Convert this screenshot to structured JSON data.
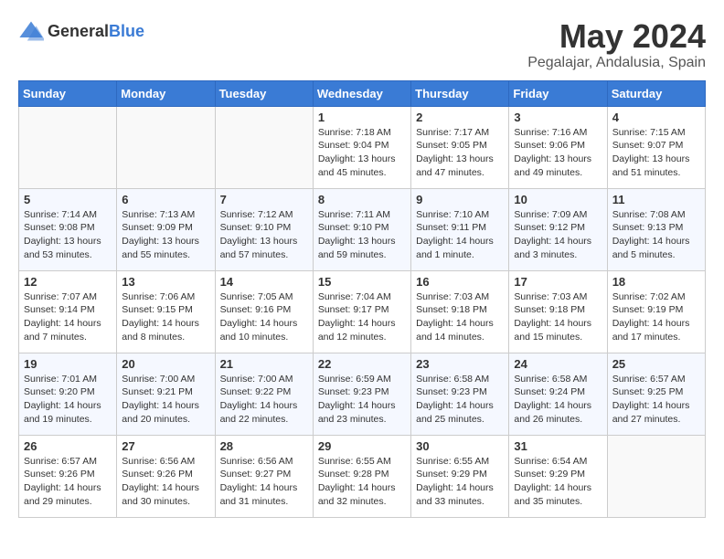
{
  "logo": {
    "general": "General",
    "blue": "Blue"
  },
  "title": "May 2024",
  "subtitle": "Pegalajar, Andalusia, Spain",
  "days": [
    "Sunday",
    "Monday",
    "Tuesday",
    "Wednesday",
    "Thursday",
    "Friday",
    "Saturday"
  ],
  "weeks": [
    [
      {
        "date": "",
        "sunrise": "",
        "sunset": "",
        "daylight": ""
      },
      {
        "date": "",
        "sunrise": "",
        "sunset": "",
        "daylight": ""
      },
      {
        "date": "",
        "sunrise": "",
        "sunset": "",
        "daylight": ""
      },
      {
        "date": "1",
        "sunrise": "Sunrise: 7:18 AM",
        "sunset": "Sunset: 9:04 PM",
        "daylight": "Daylight: 13 hours and 45 minutes."
      },
      {
        "date": "2",
        "sunrise": "Sunrise: 7:17 AM",
        "sunset": "Sunset: 9:05 PM",
        "daylight": "Daylight: 13 hours and 47 minutes."
      },
      {
        "date": "3",
        "sunrise": "Sunrise: 7:16 AM",
        "sunset": "Sunset: 9:06 PM",
        "daylight": "Daylight: 13 hours and 49 minutes."
      },
      {
        "date": "4",
        "sunrise": "Sunrise: 7:15 AM",
        "sunset": "Sunset: 9:07 PM",
        "daylight": "Daylight: 13 hours and 51 minutes."
      }
    ],
    [
      {
        "date": "5",
        "sunrise": "Sunrise: 7:14 AM",
        "sunset": "Sunset: 9:08 PM",
        "daylight": "Daylight: 13 hours and 53 minutes."
      },
      {
        "date": "6",
        "sunrise": "Sunrise: 7:13 AM",
        "sunset": "Sunset: 9:09 PM",
        "daylight": "Daylight: 13 hours and 55 minutes."
      },
      {
        "date": "7",
        "sunrise": "Sunrise: 7:12 AM",
        "sunset": "Sunset: 9:10 PM",
        "daylight": "Daylight: 13 hours and 57 minutes."
      },
      {
        "date": "8",
        "sunrise": "Sunrise: 7:11 AM",
        "sunset": "Sunset: 9:10 PM",
        "daylight": "Daylight: 13 hours and 59 minutes."
      },
      {
        "date": "9",
        "sunrise": "Sunrise: 7:10 AM",
        "sunset": "Sunset: 9:11 PM",
        "daylight": "Daylight: 14 hours and 1 minute."
      },
      {
        "date": "10",
        "sunrise": "Sunrise: 7:09 AM",
        "sunset": "Sunset: 9:12 PM",
        "daylight": "Daylight: 14 hours and 3 minutes."
      },
      {
        "date": "11",
        "sunrise": "Sunrise: 7:08 AM",
        "sunset": "Sunset: 9:13 PM",
        "daylight": "Daylight: 14 hours and 5 minutes."
      }
    ],
    [
      {
        "date": "12",
        "sunrise": "Sunrise: 7:07 AM",
        "sunset": "Sunset: 9:14 PM",
        "daylight": "Daylight: 14 hours and 7 minutes."
      },
      {
        "date": "13",
        "sunrise": "Sunrise: 7:06 AM",
        "sunset": "Sunset: 9:15 PM",
        "daylight": "Daylight: 14 hours and 8 minutes."
      },
      {
        "date": "14",
        "sunrise": "Sunrise: 7:05 AM",
        "sunset": "Sunset: 9:16 PM",
        "daylight": "Daylight: 14 hours and 10 minutes."
      },
      {
        "date": "15",
        "sunrise": "Sunrise: 7:04 AM",
        "sunset": "Sunset: 9:17 PM",
        "daylight": "Daylight: 14 hours and 12 minutes."
      },
      {
        "date": "16",
        "sunrise": "Sunrise: 7:03 AM",
        "sunset": "Sunset: 9:18 PM",
        "daylight": "Daylight: 14 hours and 14 minutes."
      },
      {
        "date": "17",
        "sunrise": "Sunrise: 7:03 AM",
        "sunset": "Sunset: 9:18 PM",
        "daylight": "Daylight: 14 hours and 15 minutes."
      },
      {
        "date": "18",
        "sunrise": "Sunrise: 7:02 AM",
        "sunset": "Sunset: 9:19 PM",
        "daylight": "Daylight: 14 hours and 17 minutes."
      }
    ],
    [
      {
        "date": "19",
        "sunrise": "Sunrise: 7:01 AM",
        "sunset": "Sunset: 9:20 PM",
        "daylight": "Daylight: 14 hours and 19 minutes."
      },
      {
        "date": "20",
        "sunrise": "Sunrise: 7:00 AM",
        "sunset": "Sunset: 9:21 PM",
        "daylight": "Daylight: 14 hours and 20 minutes."
      },
      {
        "date": "21",
        "sunrise": "Sunrise: 7:00 AM",
        "sunset": "Sunset: 9:22 PM",
        "daylight": "Daylight: 14 hours and 22 minutes."
      },
      {
        "date": "22",
        "sunrise": "Sunrise: 6:59 AM",
        "sunset": "Sunset: 9:23 PM",
        "daylight": "Daylight: 14 hours and 23 minutes."
      },
      {
        "date": "23",
        "sunrise": "Sunrise: 6:58 AM",
        "sunset": "Sunset: 9:23 PM",
        "daylight": "Daylight: 14 hours and 25 minutes."
      },
      {
        "date": "24",
        "sunrise": "Sunrise: 6:58 AM",
        "sunset": "Sunset: 9:24 PM",
        "daylight": "Daylight: 14 hours and 26 minutes."
      },
      {
        "date": "25",
        "sunrise": "Sunrise: 6:57 AM",
        "sunset": "Sunset: 9:25 PM",
        "daylight": "Daylight: 14 hours and 27 minutes."
      }
    ],
    [
      {
        "date": "26",
        "sunrise": "Sunrise: 6:57 AM",
        "sunset": "Sunset: 9:26 PM",
        "daylight": "Daylight: 14 hours and 29 minutes."
      },
      {
        "date": "27",
        "sunrise": "Sunrise: 6:56 AM",
        "sunset": "Sunset: 9:26 PM",
        "daylight": "Daylight: 14 hours and 30 minutes."
      },
      {
        "date": "28",
        "sunrise": "Sunrise: 6:56 AM",
        "sunset": "Sunset: 9:27 PM",
        "daylight": "Daylight: 14 hours and 31 minutes."
      },
      {
        "date": "29",
        "sunrise": "Sunrise: 6:55 AM",
        "sunset": "Sunset: 9:28 PM",
        "daylight": "Daylight: 14 hours and 32 minutes."
      },
      {
        "date": "30",
        "sunrise": "Sunrise: 6:55 AM",
        "sunset": "Sunset: 9:29 PM",
        "daylight": "Daylight: 14 hours and 33 minutes."
      },
      {
        "date": "31",
        "sunrise": "Sunrise: 6:54 AM",
        "sunset": "Sunset: 9:29 PM",
        "daylight": "Daylight: 14 hours and 35 minutes."
      },
      {
        "date": "",
        "sunrise": "",
        "sunset": "",
        "daylight": ""
      }
    ]
  ]
}
